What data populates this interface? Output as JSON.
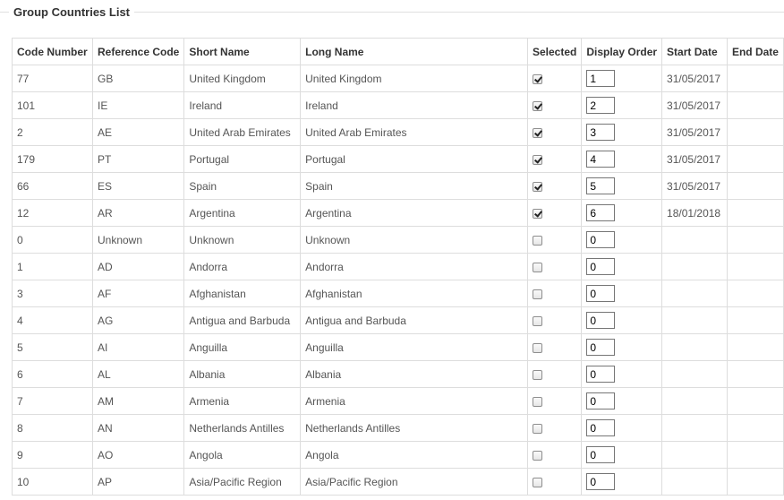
{
  "fieldset": {
    "legend": "Group Countries List"
  },
  "table": {
    "headers": {
      "code": "Code Number",
      "ref": "Reference Code",
      "short": "Short Name",
      "long": "Long Name",
      "selected": "Selected",
      "order": "Display Order",
      "start": "Start Date",
      "end": "End Date"
    },
    "rows": [
      {
        "code": "77",
        "ref": "GB",
        "short": "United Kingdom",
        "long": "United Kingdom",
        "selected": true,
        "order": "1",
        "start": "31/05/2017",
        "end": ""
      },
      {
        "code": "101",
        "ref": "IE",
        "short": "Ireland",
        "long": "Ireland",
        "selected": true,
        "order": "2",
        "start": "31/05/2017",
        "end": ""
      },
      {
        "code": "2",
        "ref": "AE",
        "short": "United Arab Emirates",
        "long": "United Arab Emirates",
        "selected": true,
        "order": "3",
        "start": "31/05/2017",
        "end": ""
      },
      {
        "code": "179",
        "ref": "PT",
        "short": "Portugal",
        "long": "Portugal",
        "selected": true,
        "order": "4",
        "start": "31/05/2017",
        "end": ""
      },
      {
        "code": "66",
        "ref": "ES",
        "short": "Spain",
        "long": "Spain",
        "selected": true,
        "order": "5",
        "start": "31/05/2017",
        "end": ""
      },
      {
        "code": "12",
        "ref": "AR",
        "short": "Argentina",
        "long": "Argentina",
        "selected": true,
        "order": "6",
        "start": "18/01/2018",
        "end": ""
      },
      {
        "code": "0",
        "ref": "Unknown",
        "short": "Unknown",
        "long": "Unknown",
        "selected": false,
        "order": "0",
        "start": "",
        "end": ""
      },
      {
        "code": "1",
        "ref": "AD",
        "short": "Andorra",
        "long": "Andorra",
        "selected": false,
        "order": "0",
        "start": "",
        "end": ""
      },
      {
        "code": "3",
        "ref": "AF",
        "short": "Afghanistan",
        "long": "Afghanistan",
        "selected": false,
        "order": "0",
        "start": "",
        "end": ""
      },
      {
        "code": "4",
        "ref": "AG",
        "short": "Antigua and Barbuda",
        "long": "Antigua and Barbuda",
        "selected": false,
        "order": "0",
        "start": "",
        "end": ""
      },
      {
        "code": "5",
        "ref": "AI",
        "short": "Anguilla",
        "long": "Anguilla",
        "selected": false,
        "order": "0",
        "start": "",
        "end": ""
      },
      {
        "code": "6",
        "ref": "AL",
        "short": "Albania",
        "long": "Albania",
        "selected": false,
        "order": "0",
        "start": "",
        "end": ""
      },
      {
        "code": "7",
        "ref": "AM",
        "short": "Armenia",
        "long": "Armenia",
        "selected": false,
        "order": "0",
        "start": "",
        "end": ""
      },
      {
        "code": "8",
        "ref": "AN",
        "short": "Netherlands Antilles",
        "long": "Netherlands Antilles",
        "selected": false,
        "order": "0",
        "start": "",
        "end": ""
      },
      {
        "code": "9",
        "ref": "AO",
        "short": "Angola",
        "long": "Angola",
        "selected": false,
        "order": "0",
        "start": "",
        "end": ""
      },
      {
        "code": "10",
        "ref": "AP",
        "short": "Asia/Pacific Region",
        "long": "Asia/Pacific Region",
        "selected": false,
        "order": "0",
        "start": "",
        "end": ""
      }
    ]
  }
}
